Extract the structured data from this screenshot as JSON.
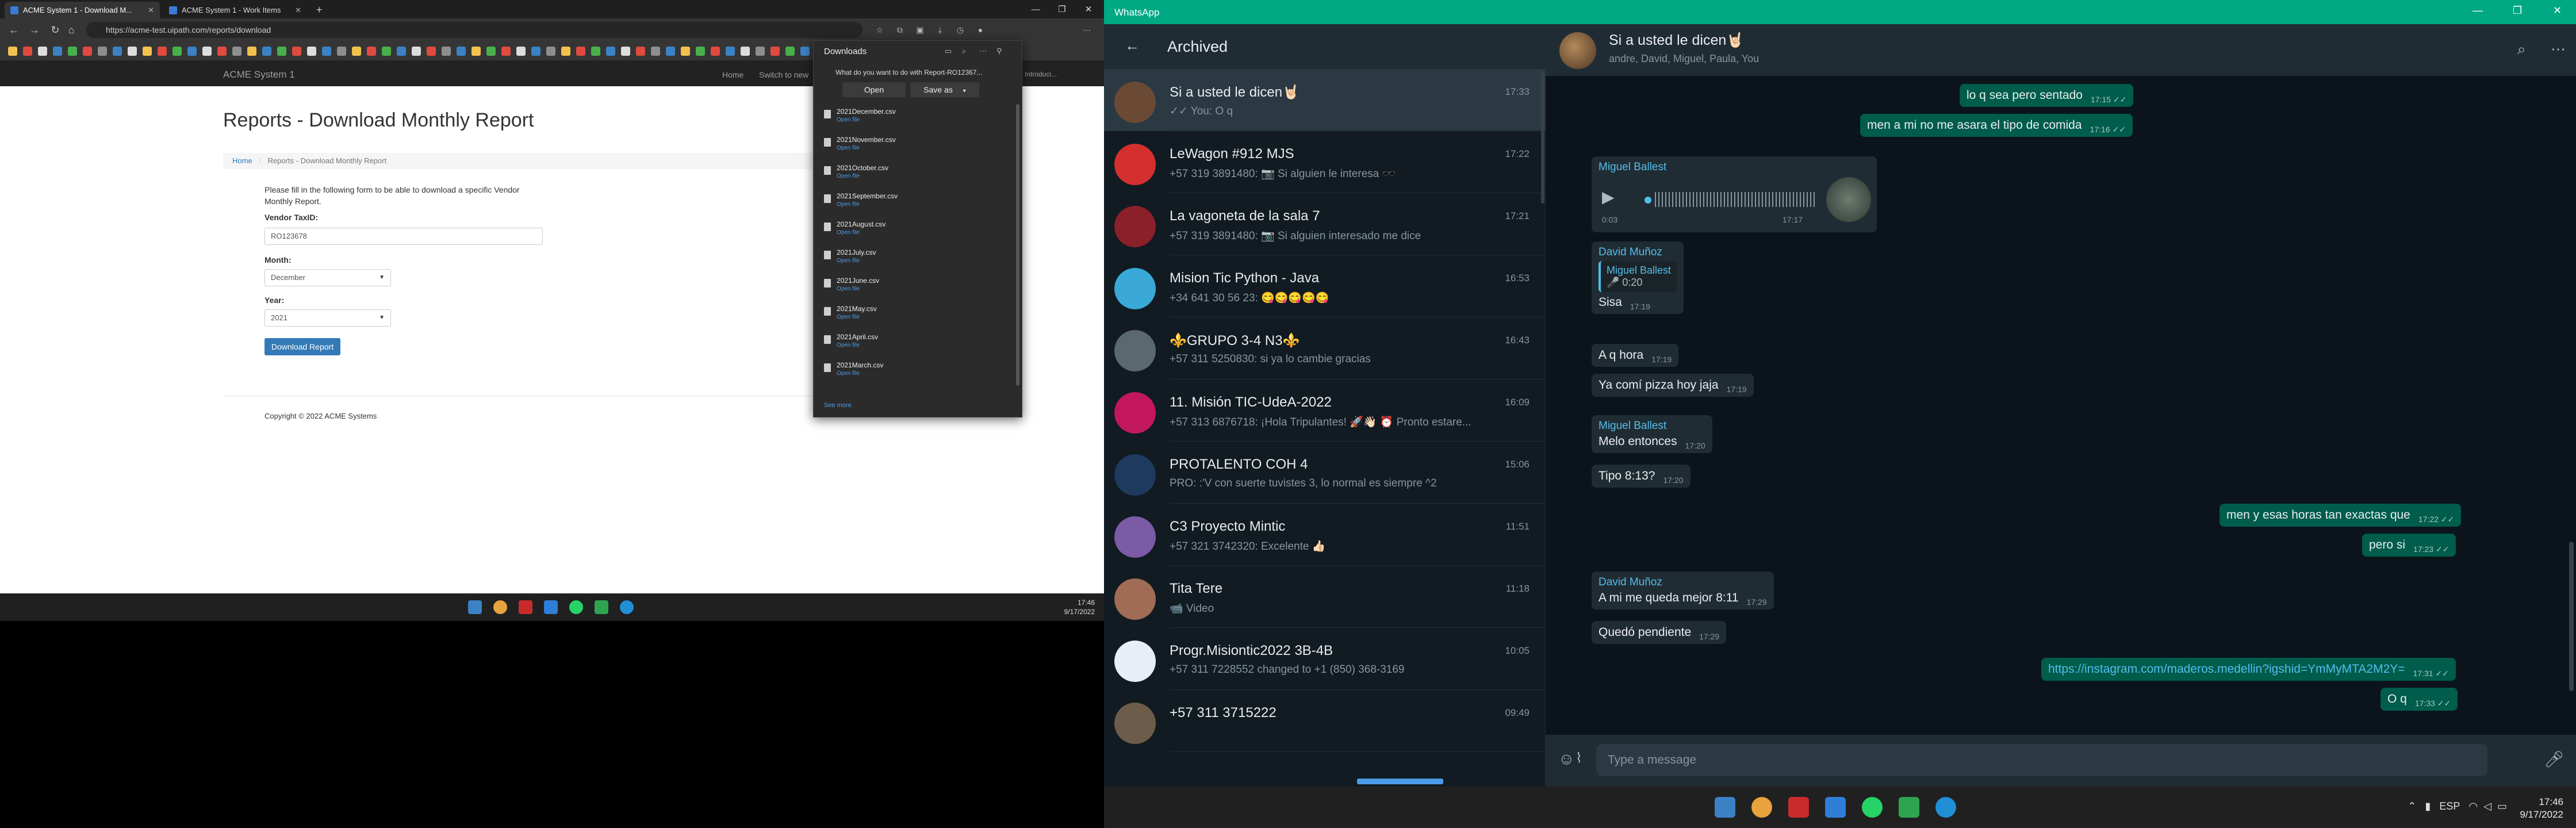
{
  "browser": {
    "tabs": [
      {
        "label": "ACME System 1 - Download M..."
      },
      {
        "label": "ACME System 1 - Work Items"
      }
    ],
    "url": "https://acme-test.uipath.com/reports/download",
    "site": {
      "brand": "ACME System 1",
      "nav": [
        "Home",
        "Switch to new",
        "Introduci..."
      ],
      "title": "Reports - Download Monthly Report",
      "breadcrumb": {
        "home": "Home",
        "current": "Reports - Download Monthly Report"
      },
      "intro": "Please fill in the following form to be able to download a specific Vendor Monthly Report.",
      "vendor_label": "Vendor TaxID:",
      "vendor_value": "RO123678",
      "month_label": "Month:",
      "month_value": "December",
      "year_label": "Year:",
      "year_value": "2021",
      "download_button": "Download Report",
      "copyright": "Copyright © 2022 ACME Systems"
    }
  },
  "downloads": {
    "title": "Downloads",
    "prompt": "What do you want to do with Report-RO12367...",
    "open_label": "Open",
    "saveas_label": "Save as",
    "open_file_label": "Open file",
    "items": [
      "2021December.csv",
      "2021November.csv",
      "2021October.csv",
      "2021September.csv",
      "2021August.csv",
      "2021July.csv",
      "2021June.csv",
      "2021May.csv",
      "2021April.csv",
      "2021March.csv"
    ],
    "see_more": "See more"
  },
  "taskbar_left": {
    "time": "17:46",
    "date": "9/17/2022"
  },
  "whatsapp": {
    "window_title": "WhatsApp",
    "archived_title": "Archived",
    "chats": [
      {
        "name": "Si a usted le dicen🤘🏻",
        "last": "✓✓ You: O q",
        "time": "17:33"
      },
      {
        "name": "LeWagon #912 MJS",
        "last": "+57 319 3891480: 📷 Si alguien le interesa 🕶️",
        "time": "17:22"
      },
      {
        "name": "La vagoneta de la sala 7",
        "last": "+57 319 3891480: 📷 Si alguien interesado me dice",
        "time": "17:21"
      },
      {
        "name": "Mision Tic Python - Java",
        "last": "+34 641 30 56 23: 😋😋😋😋😋",
        "time": "16:53"
      },
      {
        "name": "⚜️GRUPO 3-4 N3⚜️",
        "last": "+57 311 5250830: si ya lo cambie gracias",
        "time": "16:43"
      },
      {
        "name": "11. Misión TIC-UdeA-2022",
        "last": "+57 313 6876718: ¡Hola Tripulantes! 🚀👋🏻 ⏰ Pronto estare...",
        "time": "16:09"
      },
      {
        "name": "PROTALENTO COH 4",
        "last": "PRO: :'V con suerte tuvistes 3, lo normal es siempre ^2",
        "time": "15:06"
      },
      {
        "name": "C3 Proyecto Mintic",
        "last": "+57 321 3742320: Excelente 👍🏻",
        "time": "11:51"
      },
      {
        "name": "Tita Tere",
        "last": "📹 Video",
        "time": "11:18"
      },
      {
        "name": "Progr.Misiontic2022 3B-4B",
        "last": "+57 311 7228552 changed to +1 (850) 368-3169",
        "time": "10:05"
      },
      {
        "name": "+57 311 3715222",
        "last": "",
        "time": "09:49"
      }
    ],
    "chat": {
      "name": "Si a usted le dicen🤘🏻",
      "members": "andre, David, Miguel, Paula, You",
      "input_placeholder": "Type a message",
      "messages": {
        "m1": {
          "text": "lo q sea pero sentado",
          "time": "17:15"
        },
        "m2": {
          "text": "men a mi no me asara el tipo de comida",
          "time": "17:16"
        },
        "m3": {
          "sender": "Miguel Ballest",
          "duration": "0:03",
          "time": "17:17"
        },
        "m4": {
          "sender": "David Muñoz",
          "quote_name": "Miguel Ballest",
          "quote_text": "🎤 0:20",
          "text": "Sisa",
          "time": "17:19"
        },
        "m5": {
          "text": "A q  hora",
          "time": "17:19"
        },
        "m6": {
          "text": "Ya comí pizza hoy jaja",
          "time": "17:19"
        },
        "m7": {
          "sender": "Miguel Ballest",
          "text": "Melo entonces",
          "time": "17:20"
        },
        "m8": {
          "text": "Tipo 8:13?",
          "time": "17:20"
        },
        "m9": {
          "text": "men y esas horas tan exactas que",
          "time": "17:22"
        },
        "m10": {
          "text": "pero si",
          "time": "17:23"
        },
        "m11": {
          "sender": "David Muñoz",
          "text": "A mi me queda mejor 8:11",
          "time": "17:29"
        },
        "m12": {
          "text": "Quedó pendiente",
          "time": "17:29"
        },
        "m13": {
          "text": "https://instagram.com/maderos.medellin?igshid=YmMyMTA2M2Y=",
          "time": "17:31"
        },
        "m14": {
          "text": "O q",
          "time": "17:33"
        }
      }
    }
  },
  "taskbar_right": {
    "lang": "ESP",
    "time": "17:46",
    "date": "9/17/2022"
  }
}
